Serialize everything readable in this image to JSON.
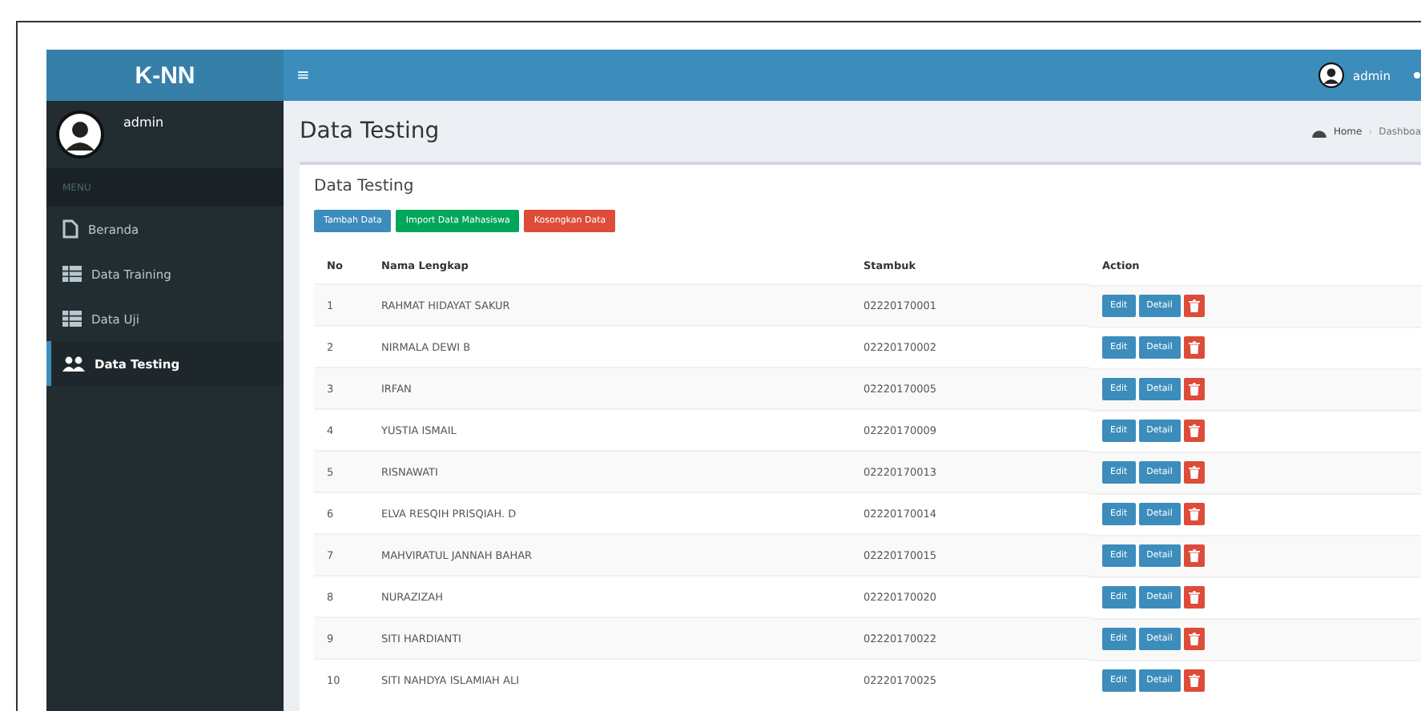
{
  "brand": "K-NN",
  "user": {
    "name": "admin",
    "menu_label": "MENU"
  },
  "sidebar": {
    "items": [
      {
        "label": "Beranda",
        "selected": false
      },
      {
        "label": "Data Training",
        "selected": false
      },
      {
        "label": "Data Uji",
        "selected": false
      },
      {
        "label": "Data Testing",
        "selected": true
      }
    ]
  },
  "topbar": {
    "menu_glyph": "≡",
    "user": "admin"
  },
  "page": {
    "title": "Data Testing",
    "breadcrumb": [
      "Home",
      "Dashboa"
    ],
    "breadcrumb_separator": "›"
  },
  "box": {
    "title": "Data Testing",
    "buttons": [
      {
        "label": "Tambah Data",
        "color": "#3c8dbc"
      },
      {
        "label": "Import Data Mahasiswa",
        "color": "#00a65a"
      },
      {
        "label": "Kosongkan Data",
        "color": "#dd4b39"
      }
    ]
  },
  "table": {
    "columns": [
      "No",
      "Nama Lengkap",
      "Stambuk",
      "Action"
    ],
    "rows": [
      {
        "no": "1",
        "name": "RAHMAT HIDAYAT SAKUR",
        "stambuk": "02220170001",
        "actions": [
          "Edit",
          "Detail"
        ]
      },
      {
        "no": "2",
        "name": "NIRMALA DEWI B",
        "stambuk": "02220170002",
        "actions": [
          "Edit",
          "Detail"
        ]
      },
      {
        "no": "3",
        "name": "IRFAN",
        "stambuk": "02220170005",
        "actions": [
          "Edit",
          "Detail"
        ]
      },
      {
        "no": "4",
        "name": "YUSTIA ISMAIL",
        "stambuk": "02220170009",
        "actions": [
          "Edit",
          "Detail"
        ]
      },
      {
        "no": "5",
        "name": "RISNAWATI",
        "stambuk": "02220170013",
        "actions": [
          "Edit",
          "Detail"
        ]
      },
      {
        "no": "6",
        "name": "ELVA RESQIH PRISQIAH. D",
        "stambuk": "02220170014",
        "actions": [
          "Edit",
          "Detail"
        ]
      },
      {
        "no": "7",
        "name": "MAHVIRATUL JANNAH BAHAR",
        "stambuk": "02220170015",
        "actions": [
          "Edit",
          "Detail"
        ]
      },
      {
        "no": "8",
        "name": "NURAZIZAH",
        "stambuk": "02220170020",
        "actions": [
          "Edit",
          "Detail"
        ]
      },
      {
        "no": "9",
        "name": "SITI HARDIANTI",
        "stambuk": "02220170022",
        "actions": [
          "Edit",
          "Detail"
        ]
      },
      {
        "no": "10",
        "name": "SITI NAHDYA ISLAMIAH ALI",
        "stambuk": "02220170025",
        "actions": [
          "Edit",
          "Detail"
        ]
      }
    ]
  }
}
